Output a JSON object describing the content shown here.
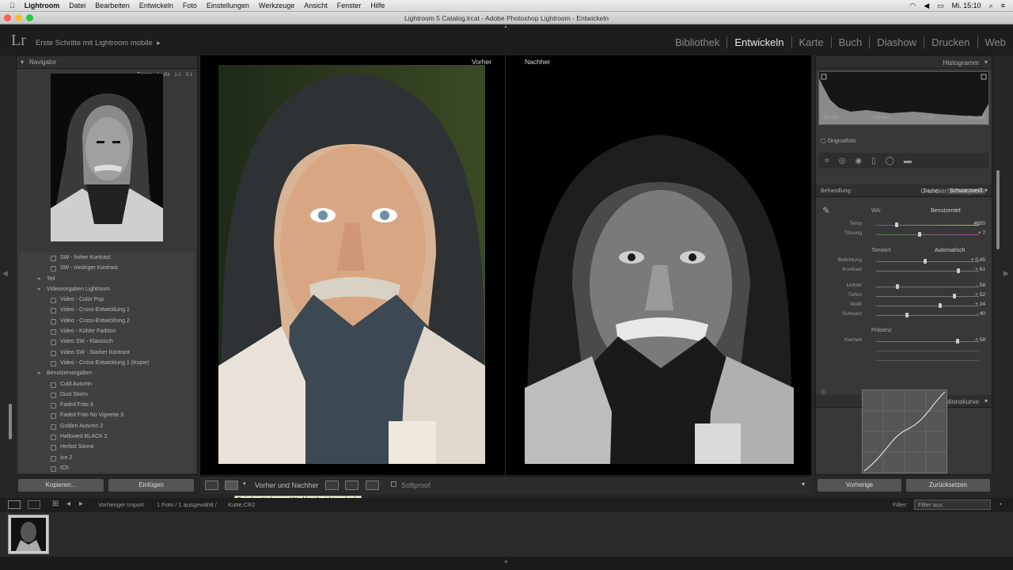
{
  "menubar": {
    "apple": "",
    "items": [
      "Lightroom",
      "Datei",
      "Bearbeiten",
      "Entwickeln",
      "Foto",
      "Einstellungen",
      "Werkzeuge",
      "Ansicht",
      "Fenster",
      "Hilfe"
    ],
    "clock": "Mi. 15:10"
  },
  "window": {
    "title": "Lightroom 5 Catalog.lrcat - Adobe Photoshop Lightroom - Entwickeln"
  },
  "identity": {
    "logo": "Lr",
    "catalog": "Erste Schritte mit Lightroom mobile"
  },
  "modules": [
    "Bibliothek",
    "Entwickeln",
    "Karte",
    "Buch",
    "Diashow",
    "Drucken",
    "Web"
  ],
  "left": {
    "navigator_title": "Navigator",
    "nav_zoom": [
      "Einpas",
      "Ausfül",
      "1:1",
      "3:1"
    ],
    "presets": [
      {
        "label": "SW - hoher Kontrast",
        "type": "item"
      },
      {
        "label": "SW - niedriger Kontrast",
        "type": "item"
      },
      {
        "label": "Teil",
        "type": "folder"
      },
      {
        "label": "Videovorgaben Lightroom",
        "type": "folder"
      },
      {
        "label": "Video - Color Pop",
        "type": "item"
      },
      {
        "label": "Video - Cross-Entwicklung 1",
        "type": "item"
      },
      {
        "label": "Video - Cross-Entwicklung 2",
        "type": "item"
      },
      {
        "label": "Video - Kühler Farbton",
        "type": "item"
      },
      {
        "label": "Video SW - Klassisch",
        "type": "item"
      },
      {
        "label": "Video SW - Starker Kontrast",
        "type": "item"
      },
      {
        "label": "Video - Cross-Entwicklung 1 (Kopie)",
        "type": "item"
      },
      {
        "label": "Benutzervorgaben",
        "type": "folder"
      },
      {
        "label": "Cold Autumn",
        "type": "item"
      },
      {
        "label": "Dust Storm",
        "type": "item"
      },
      {
        "label": "Faded Foto 3",
        "type": "item"
      },
      {
        "label": "Faded Foto No Vignette 3",
        "type": "item"
      },
      {
        "label": "Golden Autumn 2",
        "type": "item"
      },
      {
        "label": "Hallowed BLACK 2",
        "type": "item"
      },
      {
        "label": "Herbst Sonne",
        "type": "item"
      },
      {
        "label": "Ice 2",
        "type": "item"
      },
      {
        "label": "ICh",
        "type": "item"
      }
    ],
    "copy_btn": "Kopieren...",
    "paste_btn": "Einfügen"
  },
  "center": {
    "before_label": "Vorher",
    "after_label": "Nachher",
    "toolbar_view_label": "Vorher und Nachher",
    "softproof_label": "Softproof",
    "tooltip": "Zwischen Vorher- und Nachher-Ansicht wechseln"
  },
  "right": {
    "histogram_title": "Histogramm",
    "histo_info": [
      "ISO 100",
      "100 mm",
      "f / 13",
      "1/₁₂₅ Sek"
    ],
    "original_photo": "Originalfoto",
    "basic_title": "Grundeinstellungen",
    "treatment_label": "Behandlung:",
    "color_option": "Farbe",
    "bw_option": "Schwarzweiß",
    "wb_label": "WA:",
    "wb_value": "Benutzerdef.",
    "temp_label": "Temp",
    "temp_value": "4650",
    "tint_label": "Tönung",
    "tint_value": "+ 7",
    "tone_label": "Tonwert",
    "auto_label": "Automatisch",
    "sliders": [
      {
        "label": "Belichtung",
        "value": "+ 0,45",
        "pos": 0.48
      },
      {
        "label": "Kontrast",
        "value": "+ 61",
        "pos": 0.8
      },
      {
        "label": "Lichter",
        "value": "- 58",
        "pos": 0.21
      },
      {
        "label": "Tiefen",
        "value": "+ 52",
        "pos": 0.76
      },
      {
        "label": "Weiß",
        "value": "+ 24",
        "pos": 0.62
      },
      {
        "label": "Schwarz",
        "value": "- 40",
        "pos": 0.3
      }
    ],
    "presence_label": "Präsenz",
    "clarity_label": "Klarheit",
    "clarity_value": "+ 58",
    "clarity_pos": 0.79,
    "curve_title": "Gradationskurve",
    "prev_btn": "Vorherige",
    "reset_btn": "Zurücksetzen"
  },
  "filmstrip": {
    "source": "Vorheriger Import",
    "count": "1 Foto / 1 ausgewählt / ",
    "filename": "Kutte.CR2",
    "filter_label": "Filter:",
    "filter_value": "Filter aus"
  }
}
